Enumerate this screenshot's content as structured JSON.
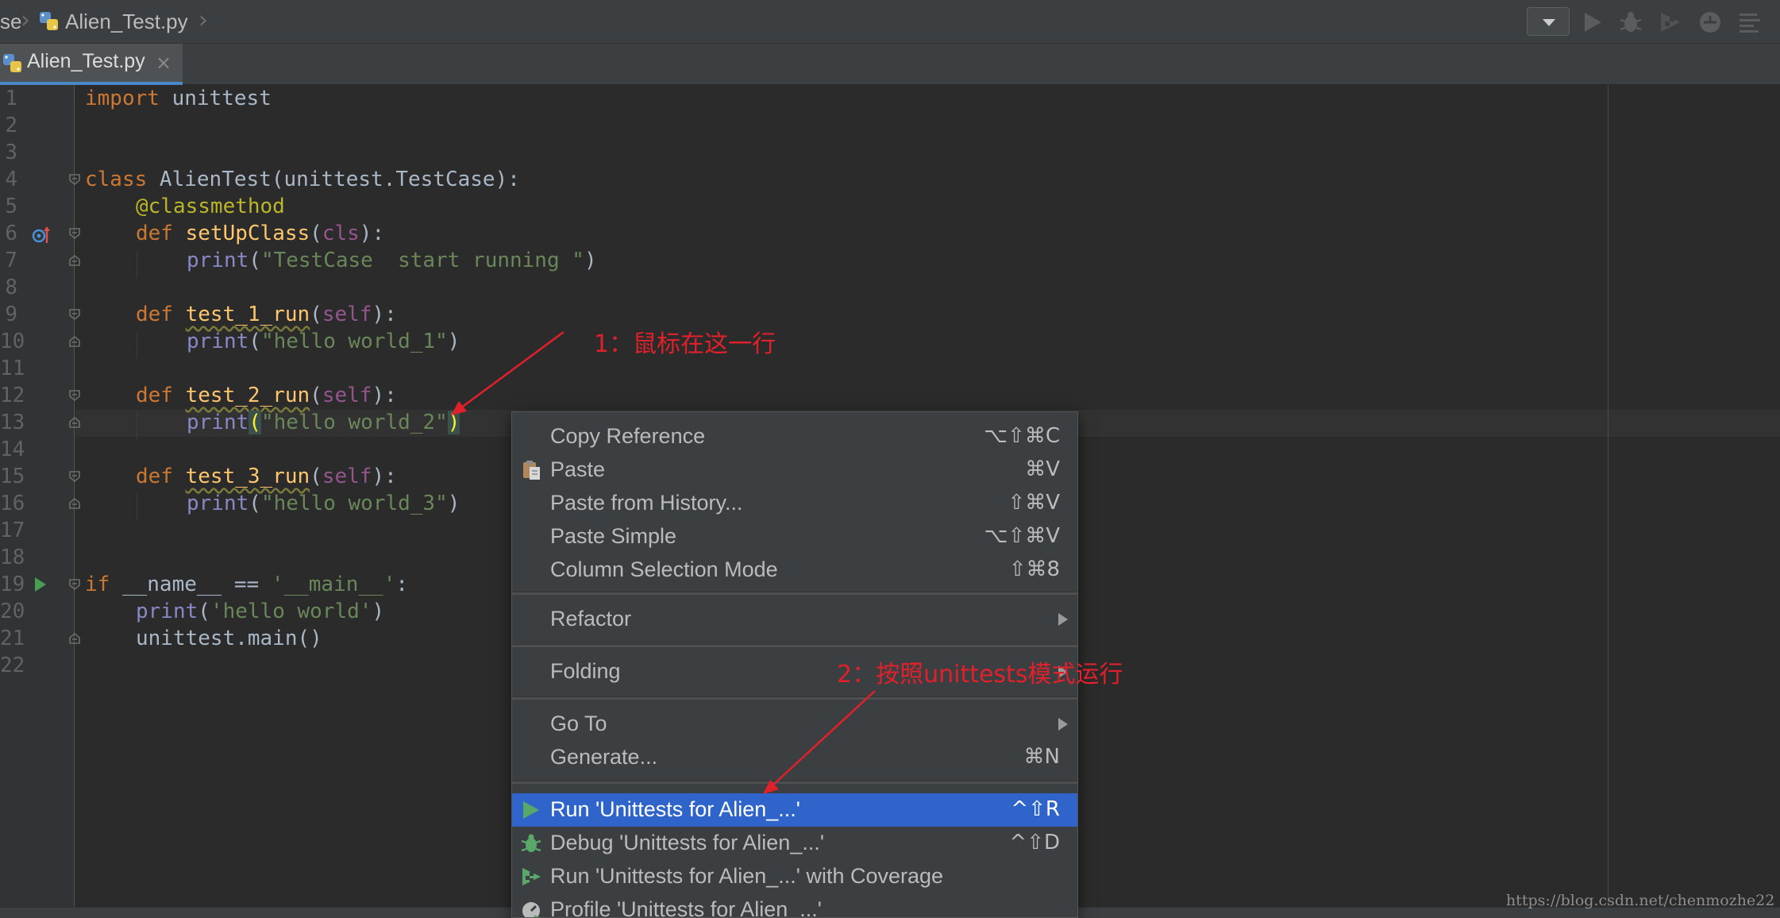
{
  "navbar": {
    "crumb_partial": "se",
    "file_name": "Alien_Test.py"
  },
  "tab": {
    "label": "Alien_Test.py",
    "close": "×"
  },
  "line_numbers": [
    "1",
    "2",
    "3",
    "4",
    "5",
    "6",
    "7",
    "8",
    "9",
    "10",
    "11",
    "12",
    "13",
    "14",
    "15",
    "16",
    "17",
    "18",
    "19",
    "20",
    "21",
    "22"
  ],
  "code": {
    "l1_kw": "import",
    "l1_rest": " unittest",
    "l4_kw": "class",
    "l4_rest": " AlienTest(unittest.TestCase):",
    "l5_dec": "@classmethod",
    "l6_kw": "def",
    "l6_fn": "setUpClass",
    "l6_open": "(",
    "l6_param": "cls",
    "l6_close": "):",
    "l7_fn": "print",
    "l7_open": "(",
    "l7_str": "\"TestCase  start running \"",
    "l7_close": ")",
    "l9_kw": "def",
    "l9_fn": "test_1_run",
    "l9_open": "(",
    "l9_param": "self",
    "l9_close": "):",
    "l10_fn": "print",
    "l10_open": "(",
    "l10_str": "\"hello world_1\"",
    "l10_close": ")",
    "l12_kw": "def",
    "l12_fn": "test_2_run",
    "l12_open": "(",
    "l12_param": "self",
    "l12_close": "):",
    "l13_fn": "print",
    "l13_open": "(",
    "l13_str": "\"hello world_2\"",
    "l13_close": ")",
    "l15_kw": "def",
    "l15_fn": "test_3_run",
    "l15_open": "(",
    "l15_param": "self",
    "l15_close": "):",
    "l16_fn": "print",
    "l16_open": "(",
    "l16_str": "\"hello world_3\"",
    "l16_close": ")",
    "l19_kw": "if",
    "l19_mid": " __name__ == ",
    "l19_str": "'__main__'",
    "l19_end": ":",
    "l20_fn": "print",
    "l20_open": "(",
    "l20_str": "'hello world'",
    "l20_close": ")",
    "l21": "unittest.main()"
  },
  "context_menu": {
    "items": [
      {
        "label": "Copy Reference",
        "shortcut": "⌥⇧⌘C"
      },
      {
        "label": "Paste",
        "shortcut": "⌘V",
        "icon": "clipboard-icon"
      },
      {
        "label": "Paste from History...",
        "shortcut": "⇧⌘V"
      },
      {
        "label": "Paste Simple",
        "shortcut": "⌥⇧⌘V"
      },
      {
        "label": "Column Selection Mode",
        "shortcut": "⇧⌘8"
      },
      {
        "label": "Refactor",
        "submenu": true
      },
      {
        "label": "Folding",
        "submenu": true
      },
      {
        "label": "Go To",
        "submenu": true
      },
      {
        "label": "Generate...",
        "shortcut": "⌘N"
      },
      {
        "label": "Run 'Unittests for Alien_...'",
        "shortcut": "^⇧R",
        "icon": "run-icon",
        "selected": true
      },
      {
        "label": "Debug 'Unittests for Alien_...'",
        "shortcut": "^⇧D",
        "icon": "debug-icon"
      },
      {
        "label": "Run 'Unittests for Alien_...' with Coverage",
        "icon": "coverage-icon"
      },
      {
        "label": "Profile 'Unittests for Alien_...'",
        "icon": "profile-icon"
      }
    ]
  },
  "annotations": {
    "note1": "1：鼠标在这一行",
    "note2": "2：按照unittests模式运行"
  },
  "watermark": "https://blog.csdn.net/chenmozhe22",
  "colors": {
    "editor_bg": "#2b2b2b",
    "keyword": "#cc7832",
    "function": "#ffc66d",
    "string": "#6a8759",
    "selection": "#2f65ca",
    "annotation": "#e0202a"
  }
}
